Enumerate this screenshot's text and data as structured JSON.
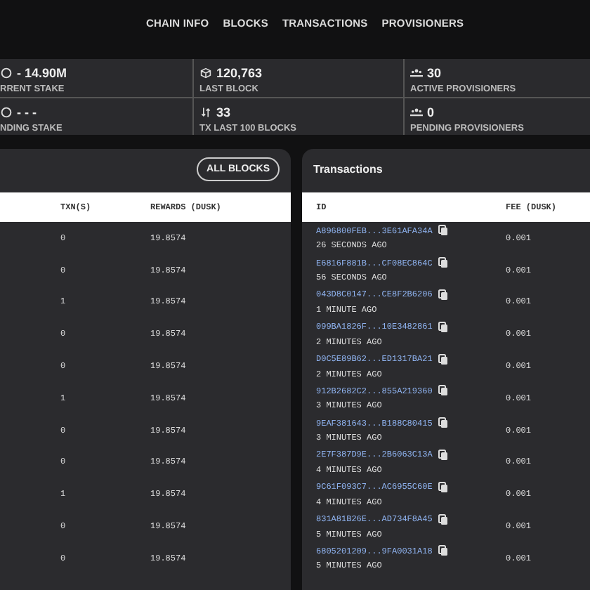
{
  "nav": [
    {
      "label": "CHAIN INFO"
    },
    {
      "label": "BLOCKS"
    },
    {
      "label": "TRANSACTIONS"
    },
    {
      "label": "PROVISIONERS"
    }
  ],
  "stats": [
    {
      "kind": "stake",
      "value": "- 14.90M",
      "label": "RRENT STAKE"
    },
    {
      "kind": "block",
      "value": "120,763",
      "label": "LAST BLOCK"
    },
    {
      "kind": "people",
      "value": "30",
      "label": "ACTIVE PROVISIONERS"
    },
    {
      "kind": "stake",
      "value": "- - -",
      "label": "NDING STAKE"
    },
    {
      "kind": "transfer",
      "value": "33",
      "label": "TX LAST 100 BLOCKS"
    },
    {
      "kind": "people",
      "value": "0",
      "label": "PENDING PROVISIONERS"
    }
  ],
  "blocks": {
    "button": "ALL BLOCKS",
    "columns": [
      "TXN(S)",
      "REWARDS (DUSK)"
    ],
    "rows": [
      {
        "txns": "0",
        "rewards": "19.8574"
      },
      {
        "txns": "0",
        "rewards": "19.8574"
      },
      {
        "txns": "1",
        "rewards": "19.8574"
      },
      {
        "txns": "0",
        "rewards": "19.8574"
      },
      {
        "txns": "0",
        "rewards": "19.8574"
      },
      {
        "txns": "1",
        "rewards": "19.8574"
      },
      {
        "txns": "0",
        "rewards": "19.8574"
      },
      {
        "txns": "0",
        "rewards": "19.8574"
      },
      {
        "txns": "1",
        "rewards": "19.8574"
      },
      {
        "txns": "0",
        "rewards": "19.8574"
      },
      {
        "txns": "0",
        "rewards": "19.8574"
      }
    ]
  },
  "transactions": {
    "title": "Transactions",
    "columns": [
      "ID",
      "FEE (DUSK)"
    ],
    "rows": [
      {
        "id": "A896800FEB...3E61AFA34A",
        "age": "26 SECONDS AGO",
        "fee": "0.001"
      },
      {
        "id": "E6816F881B...CF08EC864C",
        "age": "56 SECONDS AGO",
        "fee": "0.001"
      },
      {
        "id": "043D8C0147...CE8F2B6206",
        "age": "1 MINUTE AGO",
        "fee": "0.001"
      },
      {
        "id": "099BA1826F...10E3482861",
        "age": "2 MINUTES AGO",
        "fee": "0.001"
      },
      {
        "id": "D0C5E89B62...ED1317BA21",
        "age": "2 MINUTES AGO",
        "fee": "0.001"
      },
      {
        "id": "912B2682C2...855A219360",
        "age": "3 MINUTES AGO",
        "fee": "0.001"
      },
      {
        "id": "9EAF381643...B188C80415",
        "age": "3 MINUTES AGO",
        "fee": "0.001"
      },
      {
        "id": "2E7F387D9E...2B6063C13A",
        "age": "4 MINUTES AGO",
        "fee": "0.001"
      },
      {
        "id": "9C61F093C7...AC6955C60E",
        "age": "4 MINUTES AGO",
        "fee": "0.001"
      },
      {
        "id": "831A81B26E...AD734F8A45",
        "age": "5 MINUTES AGO",
        "fee": "0.001"
      },
      {
        "id": "6805201209...9FA0031A18",
        "age": "5 MINUTES AGO",
        "fee": "0.001"
      }
    ]
  }
}
